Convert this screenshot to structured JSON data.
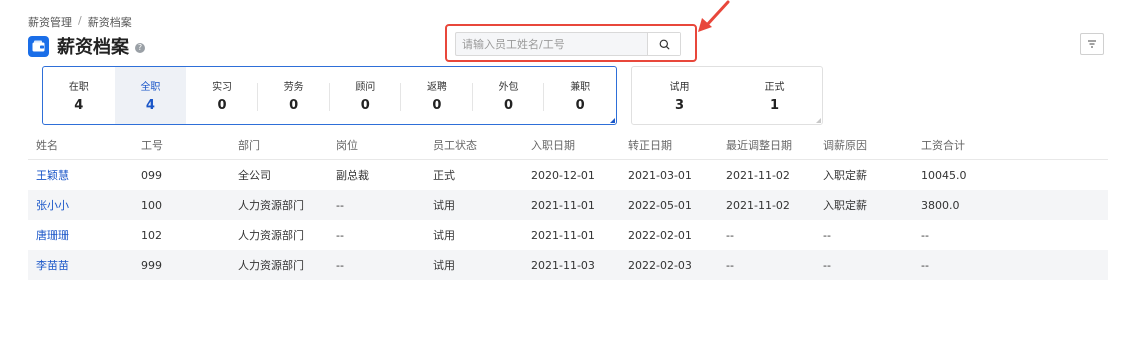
{
  "breadcrumb": {
    "parent": "薪资管理",
    "separator": "/",
    "current": "薪资档案"
  },
  "page": {
    "title": "薪资档案",
    "help": "?"
  },
  "search": {
    "placeholder": "请输入员工姓名/工号",
    "value": ""
  },
  "stats_main": [
    {
      "label": "在职",
      "value": "4"
    },
    {
      "label": "全职",
      "value": "4",
      "active": true
    },
    {
      "label": "实习",
      "value": "0"
    },
    {
      "label": "劳务",
      "value": "0"
    },
    {
      "label": "顾问",
      "value": "0"
    },
    {
      "label": "返聘",
      "value": "0"
    },
    {
      "label": "外包",
      "value": "0"
    },
    {
      "label": "兼职",
      "value": "0"
    }
  ],
  "stats_sub": [
    {
      "label": "试用",
      "value": "3"
    },
    {
      "label": "正式",
      "value": "1"
    }
  ],
  "table": {
    "headers": [
      "姓名",
      "工号",
      "部门",
      "岗位",
      "员工状态",
      "入职日期",
      "转正日期",
      "最近调整日期",
      "调薪原因",
      "工资合计"
    ],
    "rows": [
      [
        "王颖慧",
        "099",
        "全公司",
        "副总裁",
        "正式",
        "2020-12-01",
        "2021-03-01",
        "2021-11-02",
        "入职定薪",
        "10045.0"
      ],
      [
        "张小小",
        "100",
        "人力资源部门",
        "--",
        "试用",
        "2021-11-01",
        "2022-05-01",
        "2021-11-02",
        "入职定薪",
        "3800.0"
      ],
      [
        "唐珊珊",
        "102",
        "人力资源部门",
        "--",
        "试用",
        "2021-11-01",
        "2022-02-01",
        "--",
        "--",
        "--"
      ],
      [
        "李苗苗",
        "999",
        "人力资源部门",
        "--",
        "试用",
        "2021-11-03",
        "2022-02-03",
        "--",
        "--",
        "--"
      ]
    ]
  },
  "colors": {
    "accent": "#1a56c8",
    "highlight": "#e8473b",
    "stripe": "#f4f5f7"
  },
  "icons": {
    "app": "wallet-icon",
    "search": "search-icon",
    "filter": "filter-icon",
    "help": "help-icon"
  }
}
